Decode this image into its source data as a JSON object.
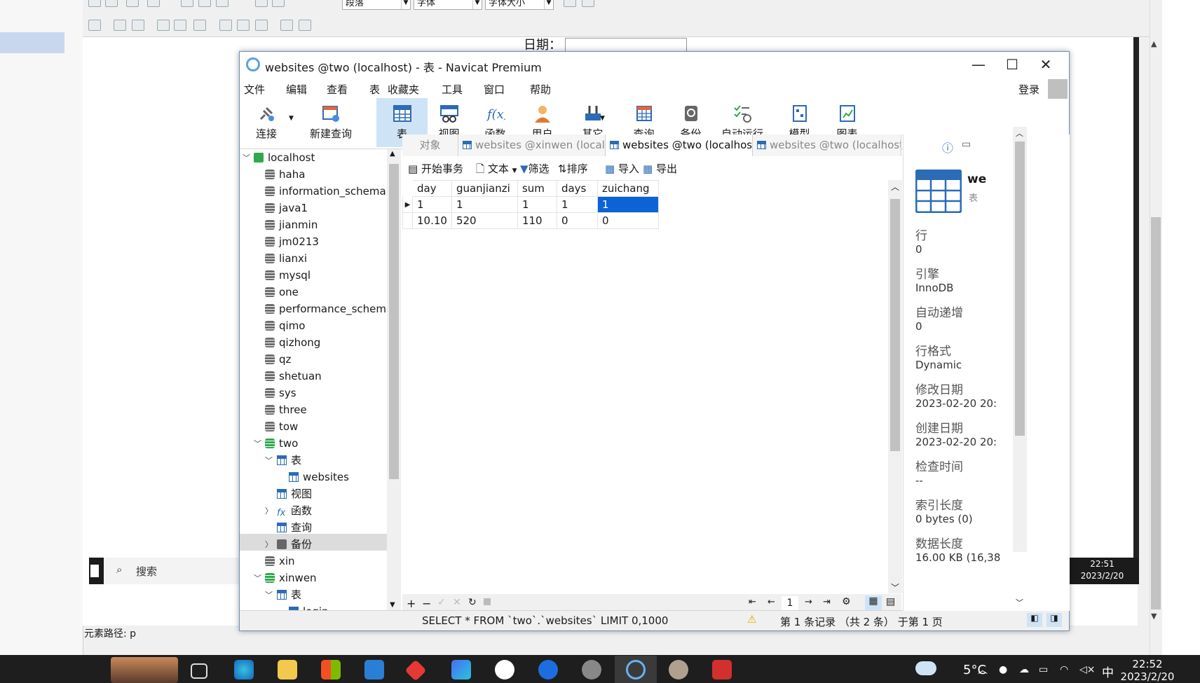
{
  "editor": {
    "toolbar_selects": [
      "段落",
      "字体",
      "字体大小"
    ],
    "date_label": "日期：",
    "status_path": "元素路径: p",
    "inner_search": "搜索",
    "inner_clock_time": "22:51",
    "inner_clock_date": "2023/2/20"
  },
  "window": {
    "title": "websites @two (localhost) - 表 - Navicat Premium",
    "minimize": "—",
    "maximize": "☐",
    "close": "✕"
  },
  "menu": {
    "items": [
      "文件",
      "编辑",
      "查看",
      "表",
      "收藏夹",
      "工具",
      "窗口",
      "帮助"
    ],
    "login": "登录"
  },
  "toolbar": {
    "buttons": [
      {
        "label": "连接",
        "icon": "plug-icon"
      },
      {
        "label": "新建查询",
        "icon": "new-query-icon"
      },
      {
        "label": "表",
        "icon": "table-icon"
      },
      {
        "label": "视图",
        "icon": "view-icon"
      },
      {
        "label": "函数",
        "icon": "function-icon"
      },
      {
        "label": "用户",
        "icon": "user-icon"
      },
      {
        "label": "其它",
        "icon": "tools-icon"
      },
      {
        "label": "查询",
        "icon": "query-icon"
      },
      {
        "label": "备份",
        "icon": "backup-icon"
      },
      {
        "label": "自动运行",
        "icon": "autorun-icon"
      },
      {
        "label": "模型",
        "icon": "model-icon"
      },
      {
        "label": "图表",
        "icon": "chart-icon"
      }
    ]
  },
  "tree": {
    "root": "localhost",
    "databases": [
      "haha",
      "information_schema",
      "java1",
      "jianmin",
      "jm0213",
      "lianxi",
      "mysql",
      "one",
      "performance_schema",
      "qimo",
      "qizhong",
      "qz",
      "shetuan",
      "sys",
      "three",
      "tow",
      "two"
    ],
    "two_children": {
      "tables": "表",
      "table_item": "websites",
      "views": "视图",
      "functions": "函数",
      "queries": "查询",
      "backups": "备份"
    },
    "after": [
      "xin",
      "xinwen"
    ],
    "xinwen_children": {
      "tables": "表",
      "table_item": "login"
    }
  },
  "tabs": [
    "对象",
    "websites @xinwen (localh...",
    "websites @two (localhost...",
    "websites @two (localhost..."
  ],
  "grid_toolbar": {
    "begin_tx": "开始事务",
    "text": "文本",
    "filter": "筛选",
    "sort": "排序",
    "import": "导入",
    "export": "导出"
  },
  "grid": {
    "columns": [
      "day",
      "guanjianzi",
      "sum",
      "days",
      "zuichang"
    ],
    "rows": [
      [
        "1",
        "1",
        "1",
        "1",
        "1"
      ],
      [
        "10.10",
        "520",
        "110",
        "0",
        "0"
      ]
    ],
    "page": "1"
  },
  "status": {
    "sql": "SELECT * FROM `two`.`websites` LIMIT 0,1000",
    "records": "第 1 条记录 （共 2 条） 于第 1 页"
  },
  "info": {
    "name_partial": "we",
    "type_partial": "表",
    "fields": [
      {
        "label": "行",
        "value": "0"
      },
      {
        "label": "引擎",
        "value": "InnoDB"
      },
      {
        "label": "自动递增",
        "value": "0"
      },
      {
        "label": "行格式",
        "value": "Dynamic"
      },
      {
        "label": "修改日期",
        "value": "2023-02-20 20:"
      },
      {
        "label": "创建日期",
        "value": "2023-02-20 20:"
      },
      {
        "label": "检查时间",
        "value": "--"
      },
      {
        "label": "索引长度",
        "value": "0 bytes (0)"
      },
      {
        "label": "数据长度",
        "value": "16.00 KB (16,38"
      }
    ]
  },
  "os": {
    "temp": "5°C",
    "ime": "中",
    "clock_time": "22:52",
    "clock_date": "2023/2/20"
  },
  "colors": {
    "accent": "#0a64d6",
    "selected_tab_bg": "#cfe3f7"
  }
}
